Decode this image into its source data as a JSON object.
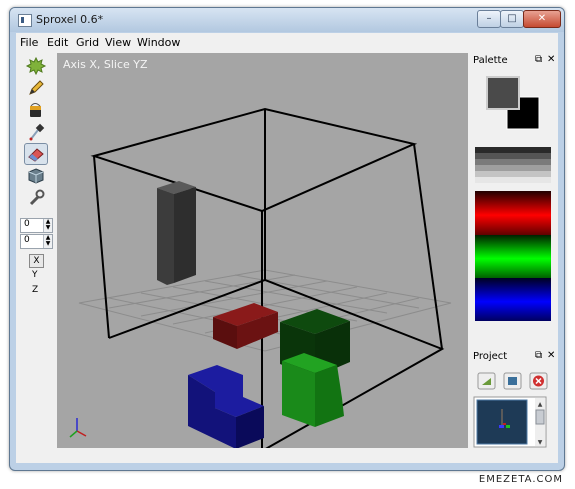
{
  "window": {
    "title": "Sproxel 0.6*",
    "minimize_glyph": "–",
    "maximize_glyph": "□",
    "close_glyph": "✕"
  },
  "menu": [
    "File",
    "Edit",
    "Grid",
    "View",
    "Window"
  ],
  "toolbar": {
    "tools": [
      "splat-icon",
      "pencil-icon",
      "paint-bucket-icon",
      "eyedropper-icon",
      "eraser-icon",
      "voxel-cube-icon",
      "wrench-icon"
    ],
    "selected_tool": "eraser-icon",
    "spin_1": "0",
    "spin_2": "0",
    "axis_selected": "X",
    "axis_y": "Y",
    "axis_z": "Z"
  },
  "viewport": {
    "label": "Axis X, Slice YZ"
  },
  "palette": {
    "title": "Palette",
    "float_glyph": "⧉",
    "close_glyph": "✕",
    "fg_color": "#4a4a4a",
    "bg_color": "#000000"
  },
  "project": {
    "title": "Project",
    "float_glyph": "⧉",
    "close_glyph": "✕",
    "buttons": [
      "new-sprite-icon",
      "sprite-settings-icon",
      "delete-sprite-icon"
    ]
  },
  "watermark": "EMEZETA.COM"
}
